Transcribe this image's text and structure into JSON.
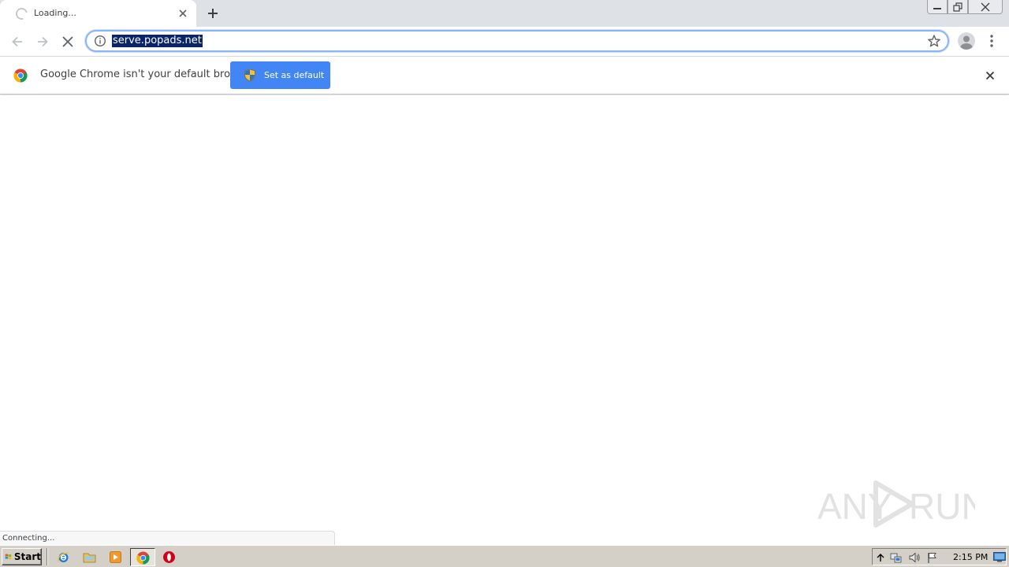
{
  "tab": {
    "title": "Loading..."
  },
  "omnibox": {
    "url": "serve.popads.net"
  },
  "infobar": {
    "message": "Google Chrome isn't your default browser",
    "button_label": "Set as default"
  },
  "status": {
    "text": "Connecting..."
  },
  "watermark": {
    "text": "ANY RUN"
  },
  "taskbar": {
    "start_label": "Start",
    "clock": "2:15 PM"
  },
  "colors": {
    "accent": "#4285f4",
    "selection": "#0a246a",
    "tabstrip": "#dee1e6",
    "taskbar": "#d4d0c8"
  }
}
